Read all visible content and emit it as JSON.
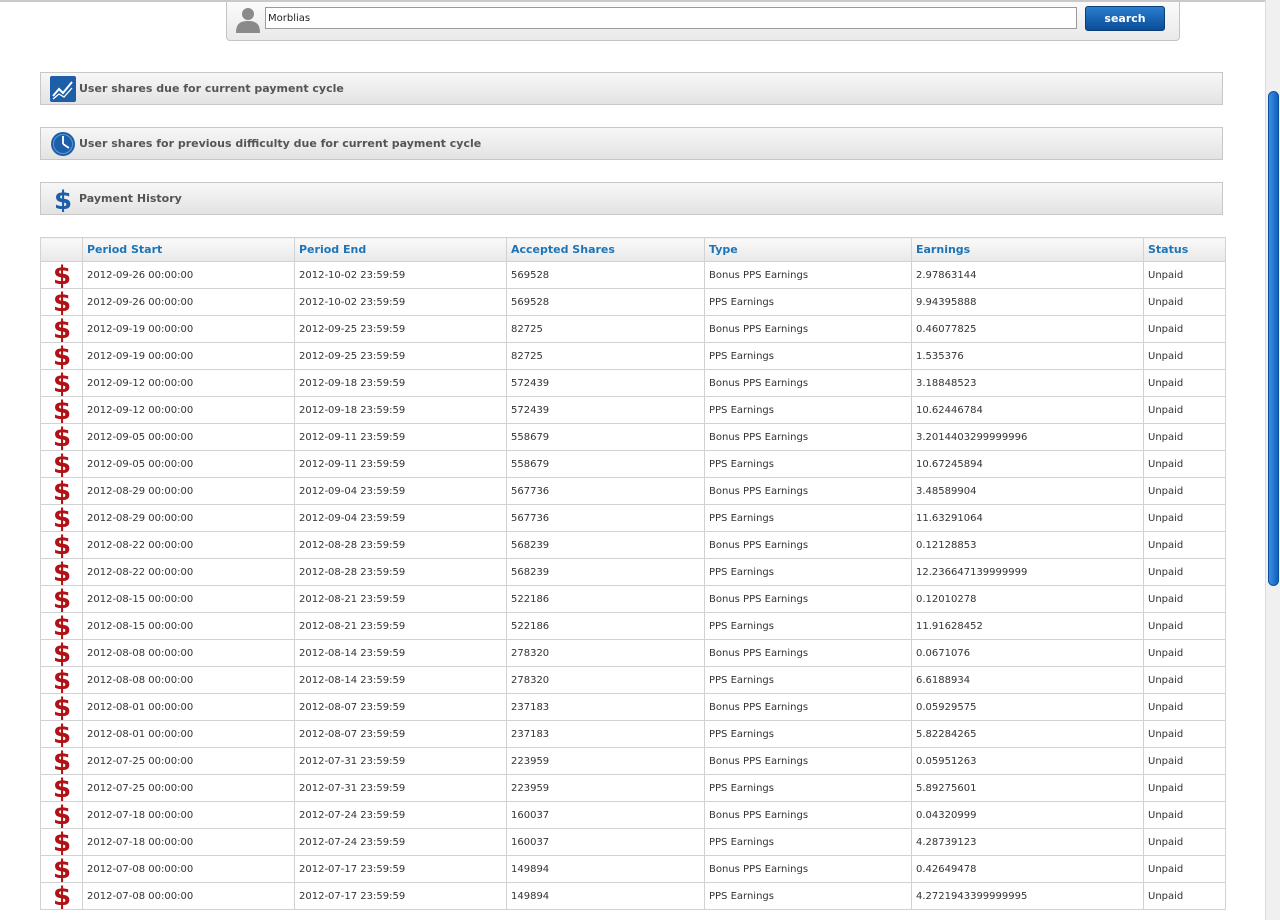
{
  "search": {
    "value": "Morblias",
    "button_label": "search"
  },
  "sections": {
    "current_shares": "User shares due for current payment cycle",
    "previous_difficulty": "User shares for previous difficulty due for current payment cycle",
    "payment_history": "Payment History"
  },
  "icons": {
    "user": "user-icon",
    "chart": "chart-icon",
    "clock": "clock-icon",
    "dollar": "dollar-icon",
    "unpaid_row": "dollar-red-icon"
  },
  "colors": {
    "accent": "#1d75b8",
    "button": "#0a4d96",
    "unpaid_icon": "#b01216",
    "paid_icon": "#5aa832"
  },
  "table": {
    "columns": [
      "",
      "Period Start",
      "Period End",
      "Accepted Shares",
      "Type",
      "Earnings",
      "Status"
    ],
    "rows": [
      {
        "start": "2012-09-26 00:00:00",
        "end": "2012-10-02 23:59:59",
        "shares": "569528",
        "type": "Bonus PPS Earnings",
        "earnings": "2.97863144",
        "status": "Unpaid"
      },
      {
        "start": "2012-09-26 00:00:00",
        "end": "2012-10-02 23:59:59",
        "shares": "569528",
        "type": "PPS Earnings",
        "earnings": "9.94395888",
        "status": "Unpaid"
      },
      {
        "start": "2012-09-19 00:00:00",
        "end": "2012-09-25 23:59:59",
        "shares": "82725",
        "type": "Bonus PPS Earnings",
        "earnings": "0.46077825",
        "status": "Unpaid"
      },
      {
        "start": "2012-09-19 00:00:00",
        "end": "2012-09-25 23:59:59",
        "shares": "82725",
        "type": "PPS Earnings",
        "earnings": "1.535376",
        "status": "Unpaid"
      },
      {
        "start": "2012-09-12 00:00:00",
        "end": "2012-09-18 23:59:59",
        "shares": "572439",
        "type": "Bonus PPS Earnings",
        "earnings": "3.18848523",
        "status": "Unpaid"
      },
      {
        "start": "2012-09-12 00:00:00",
        "end": "2012-09-18 23:59:59",
        "shares": "572439",
        "type": "PPS Earnings",
        "earnings": "10.62446784",
        "status": "Unpaid"
      },
      {
        "start": "2012-09-05 00:00:00",
        "end": "2012-09-11 23:59:59",
        "shares": "558679",
        "type": "Bonus PPS Earnings",
        "earnings": "3.2014403299999996",
        "status": "Unpaid"
      },
      {
        "start": "2012-09-05 00:00:00",
        "end": "2012-09-11 23:59:59",
        "shares": "558679",
        "type": "PPS Earnings",
        "earnings": "10.67245894",
        "status": "Unpaid"
      },
      {
        "start": "2012-08-29 00:00:00",
        "end": "2012-09-04 23:59:59",
        "shares": "567736",
        "type": "Bonus PPS Earnings",
        "earnings": "3.48589904",
        "status": "Unpaid"
      },
      {
        "start": "2012-08-29 00:00:00",
        "end": "2012-09-04 23:59:59",
        "shares": "567736",
        "type": "PPS Earnings",
        "earnings": "11.63291064",
        "status": "Unpaid"
      },
      {
        "start": "2012-08-22 00:00:00",
        "end": "2012-08-28 23:59:59",
        "shares": "568239",
        "type": "Bonus PPS Earnings",
        "earnings": "0.12128853",
        "status": "Unpaid"
      },
      {
        "start": "2012-08-22 00:00:00",
        "end": "2012-08-28 23:59:59",
        "shares": "568239",
        "type": "PPS Earnings",
        "earnings": "12.236647139999999",
        "status": "Unpaid"
      },
      {
        "start": "2012-08-15 00:00:00",
        "end": "2012-08-21 23:59:59",
        "shares": "522186",
        "type": "Bonus PPS Earnings",
        "earnings": "0.12010278",
        "status": "Unpaid"
      },
      {
        "start": "2012-08-15 00:00:00",
        "end": "2012-08-21 23:59:59",
        "shares": "522186",
        "type": "PPS Earnings",
        "earnings": "11.91628452",
        "status": "Unpaid"
      },
      {
        "start": "2012-08-08 00:00:00",
        "end": "2012-08-14 23:59:59",
        "shares": "278320",
        "type": "Bonus PPS Earnings",
        "earnings": "0.0671076",
        "status": "Unpaid"
      },
      {
        "start": "2012-08-08 00:00:00",
        "end": "2012-08-14 23:59:59",
        "shares": "278320",
        "type": "PPS Earnings",
        "earnings": "6.6188934",
        "status": "Unpaid"
      },
      {
        "start": "2012-08-01 00:00:00",
        "end": "2012-08-07 23:59:59",
        "shares": "237183",
        "type": "Bonus PPS Earnings",
        "earnings": "0.05929575",
        "status": "Unpaid"
      },
      {
        "start": "2012-08-01 00:00:00",
        "end": "2012-08-07 23:59:59",
        "shares": "237183",
        "type": "PPS Earnings",
        "earnings": "5.82284265",
        "status": "Unpaid"
      },
      {
        "start": "2012-07-25 00:00:00",
        "end": "2012-07-31 23:59:59",
        "shares": "223959",
        "type": "Bonus PPS Earnings",
        "earnings": "0.05951263",
        "status": "Unpaid"
      },
      {
        "start": "2012-07-25 00:00:00",
        "end": "2012-07-31 23:59:59",
        "shares": "223959",
        "type": "PPS Earnings",
        "earnings": "5.89275601",
        "status": "Unpaid"
      },
      {
        "start": "2012-07-18 00:00:00",
        "end": "2012-07-24 23:59:59",
        "shares": "160037",
        "type": "Bonus PPS Earnings",
        "earnings": "0.04320999",
        "status": "Unpaid"
      },
      {
        "start": "2012-07-18 00:00:00",
        "end": "2012-07-24 23:59:59",
        "shares": "160037",
        "type": "PPS Earnings",
        "earnings": "4.28739123",
        "status": "Unpaid"
      },
      {
        "start": "2012-07-08 00:00:00",
        "end": "2012-07-17 23:59:59",
        "shares": "149894",
        "type": "Bonus PPS Earnings",
        "earnings": "0.42649478",
        "status": "Unpaid"
      },
      {
        "start": "2012-07-08 00:00:00",
        "end": "2012-07-17 23:59:59",
        "shares": "149894",
        "type": "PPS Earnings",
        "earnings": "4.2721943399999995",
        "status": "Unpaid"
      }
    ]
  }
}
